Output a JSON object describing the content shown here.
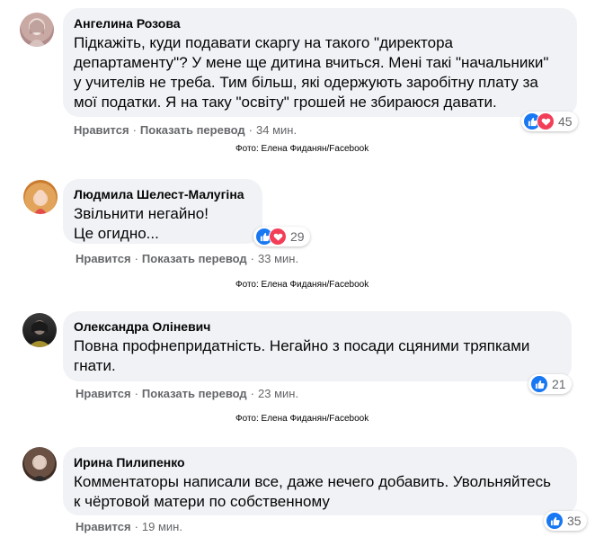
{
  "comments": [
    {
      "author": "Ангелина Розова",
      "lines": [
        "Підкажіть, куди подавати скаргу на такого \"директора",
        "департаменту\"? У мене ще дитина вчиться. Мені такі \"начальники\"",
        "у учителів не треба. Тим більш, які одержують заробітну плату за",
        "мої податки. Я на таку \"освіту\" грошей не збираюся давати."
      ],
      "like_label": "Нравится",
      "translate_label": "Показать перевод",
      "time": "34 мин.",
      "reaction_count": "45",
      "reactions": [
        "like-icon",
        "love-icon"
      ]
    },
    {
      "author": "Людмила Шелест-Малугіна",
      "lines": [
        "Звільнити негайно!",
        "Це огидно..."
      ],
      "like_label": "Нравится",
      "translate_label": "Показать перевод",
      "time": "33 мин.",
      "reaction_count": "29",
      "reactions": [
        "like-icon",
        "love-icon"
      ]
    },
    {
      "author": "Олександра Оліневич",
      "lines": [
        "Повна профнепридатність. Негайно з посади сцяними тряпками",
        "гнати."
      ],
      "like_label": "Нравится",
      "translate_label": "Показать перевод",
      "time": "23 мин.",
      "reaction_count": "21",
      "reactions": [
        "like-icon"
      ]
    },
    {
      "author": "Ирина Пилипенко",
      "lines": [
        "Комментаторы написали все, даже нечего добавить. Увольняйтесь",
        "к чёртовой матери по собственному"
      ],
      "like_label": "Нравится",
      "time": "19 мин.",
      "reaction_count": "35",
      "reactions": [
        "like-icon"
      ]
    }
  ],
  "captions": [
    "Фото: Елена Фиданян/Facebook",
    "Фото: Елена Фиданян/Facebook",
    "Фото: Елена Фиданян/Facebook"
  ],
  "colors": {
    "bubble": "#f0f2f5",
    "like_blue": "#1877f2",
    "love_red": "#f33e58",
    "meta_grey": "#65676b"
  }
}
